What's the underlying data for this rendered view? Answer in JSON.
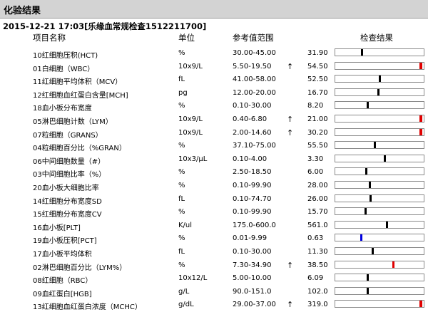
{
  "window": {
    "title": "化验结果"
  },
  "report": {
    "heading": "2015-12-21 17:03[乐缘血常规检查1512211700]"
  },
  "columns": {
    "name": "项目名称",
    "unit": "单位",
    "ref": "参考值范围",
    "result": "检查结果"
  },
  "colors": {
    "normal": "#000000",
    "high": "#e00000",
    "low": "#0000e0"
  },
  "rows": [
    {
      "name": "10红细胞压积(HCT)",
      "unit": "%",
      "ref": "30.00-45.00",
      "flag": "",
      "value": "31.90",
      "level": 0.3,
      "status": "normal"
    },
    {
      "name": "01白细胞（WBC）",
      "unit": "10x9/L",
      "ref": "5.50-19.50",
      "flag": "↑",
      "value": "54.50",
      "level": 0.98,
      "status": "high"
    },
    {
      "name": "11红细胞平均体积（MCV）",
      "unit": "fL",
      "ref": "41.00-58.00",
      "flag": "",
      "value": "52.50",
      "level": 0.5,
      "status": "normal"
    },
    {
      "name": "12红细胞血红蛋白含量[MCH]",
      "unit": "pg",
      "ref": "12.00-20.00",
      "flag": "",
      "value": "16.70",
      "level": 0.49,
      "status": "normal"
    },
    {
      "name": "18血小板分布宽度",
      "unit": "%",
      "ref": "0.10-30.00",
      "flag": "",
      "value": "8.20",
      "level": 0.36,
      "status": "normal"
    },
    {
      "name": "05淋巴细胞计数（LYM）",
      "unit": "10x9/L",
      "ref": "0.40-6.80",
      "flag": "↑",
      "value": "21.00",
      "level": 0.98,
      "status": "high"
    },
    {
      "name": "07粒细胞（GRANS）",
      "unit": "10x9/L",
      "ref": "2.00-14.60",
      "flag": "↑",
      "value": "30.20",
      "level": 0.98,
      "status": "high"
    },
    {
      "name": "04粒细胞百分比（%GRAN）",
      "unit": "%",
      "ref": "37.10-75.00",
      "flag": "",
      "value": "55.50",
      "level": 0.45,
      "status": "normal"
    },
    {
      "name": "06中间细胞数量（#）",
      "unit": "10x3/μL",
      "ref": "0.10-4.00",
      "flag": "",
      "value": "3.30",
      "level": 0.56,
      "status": "normal"
    },
    {
      "name": "03中间细胞比率（%）",
      "unit": "%",
      "ref": "2.50-18.50",
      "flag": "",
      "value": "6.00",
      "level": 0.35,
      "status": "normal"
    },
    {
      "name": "20血小板大细胞比率",
      "unit": "%",
      "ref": "0.10-99.90",
      "flag": "",
      "value": "28.00",
      "level": 0.39,
      "status": "normal"
    },
    {
      "name": "14红细胞分布宽度SD",
      "unit": "fL",
      "ref": "0.10-74.70",
      "flag": "",
      "value": "26.00",
      "level": 0.4,
      "status": "normal"
    },
    {
      "name": "15红细胞分布宽度CV",
      "unit": "%",
      "ref": "0.10-99.90",
      "flag": "",
      "value": "15.70",
      "level": 0.34,
      "status": "normal"
    },
    {
      "name": "16血小板[PLT]",
      "unit": "K/ul",
      "ref": "175.0-600.0",
      "flag": "",
      "value": "561.0",
      "level": 0.59,
      "status": "normal"
    },
    {
      "name": "19血小板压积[PCT]",
      "unit": "%",
      "ref": "0.01-9.99",
      "flag": "",
      "value": "0.63",
      "level": 0.29,
      "status": "low"
    },
    {
      "name": "17血小板平均体积",
      "unit": "fL",
      "ref": "0.10-30.00",
      "flag": "",
      "value": "11.30",
      "level": 0.42,
      "status": "normal"
    },
    {
      "name": "02淋巴细胞百分比（LYM%）",
      "unit": "%",
      "ref": "7.30-34.90",
      "flag": "↑",
      "value": "38.50",
      "level": 0.66,
      "status": "high"
    },
    {
      "name": "08红细胞（RBC）",
      "unit": "10x12/L",
      "ref": "5.00-10.00",
      "flag": "",
      "value": "6.09",
      "level": 0.36,
      "status": "normal"
    },
    {
      "name": "09血红蛋白[HGB]",
      "unit": "g/L",
      "ref": "90.0-151.0",
      "flag": "",
      "value": "102.0",
      "level": 0.36,
      "status": "normal"
    },
    {
      "name": "13红细胞血红蛋白浓度（MCHC）",
      "unit": "g/dL",
      "ref": "29.00-37.00",
      "flag": "↑",
      "value": "319.0",
      "level": 0.98,
      "status": "high"
    }
  ]
}
